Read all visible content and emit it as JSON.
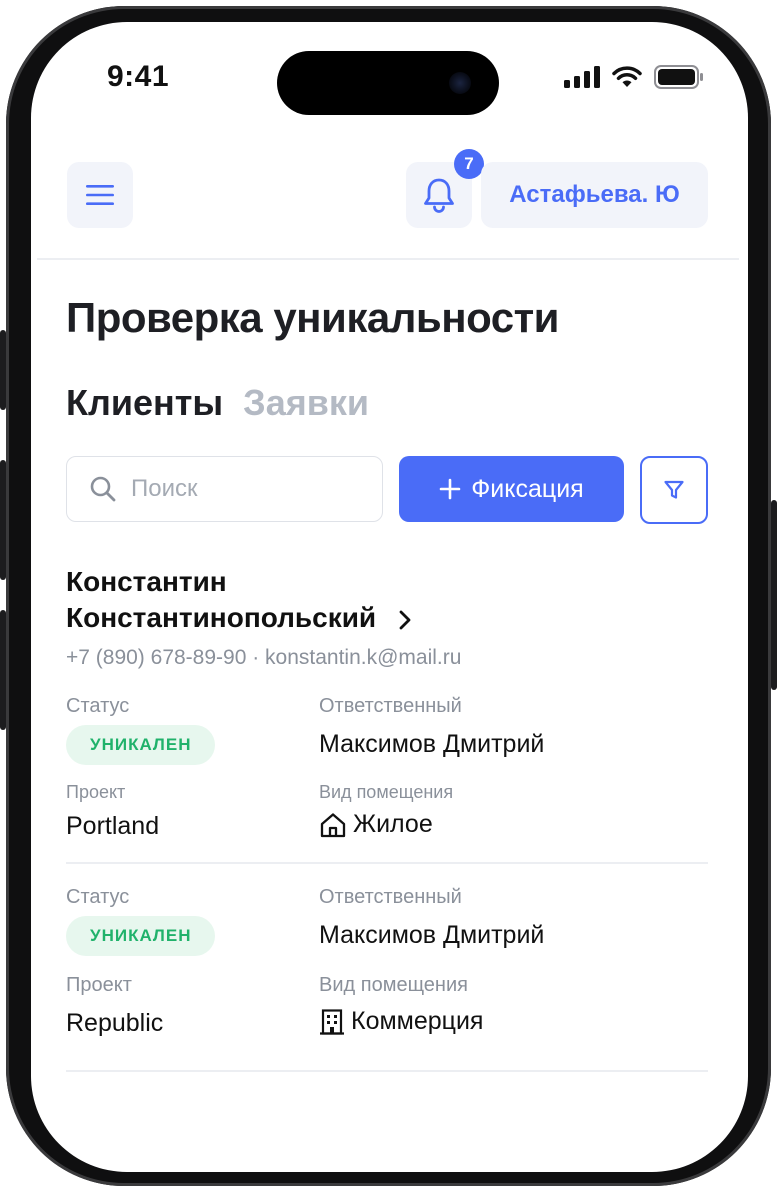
{
  "status_bar": {
    "time": "9:41"
  },
  "header": {
    "notifications_count": "7",
    "user_name": "Астафьева. Ю"
  },
  "page": {
    "title": "Проверка уникальности",
    "tabs": [
      {
        "label": "Клиенты",
        "active": true
      },
      {
        "label": "Заявки",
        "active": false
      }
    ]
  },
  "toolbar": {
    "search_placeholder": "Поиск",
    "add_button_label": "Фиксация"
  },
  "client": {
    "name_line1": "Константин",
    "name_line2": "Константинопольский",
    "contacts": "+7 (890) 678-89-90 · konstantin.k@mail.ru"
  },
  "records": [
    {
      "status_label": "Статус",
      "status_value": "УНИКАЛЕН",
      "responsible_label": "Ответственный",
      "responsible_value": "Максимов Дмитрий",
      "project_label": "Проект",
      "project_value": "Portland",
      "room_label": "Вид помещения",
      "room_value": "Жилое",
      "room_icon": "home-icon"
    },
    {
      "status_label": "Статус",
      "status_value": "УНИКАЛЕН",
      "responsible_label": "Ответственный",
      "responsible_value": "Максимов Дмитрий",
      "project_label": "Проект",
      "project_value": "Republic",
      "room_label": "Вид помещения",
      "room_value": "Коммерция",
      "room_icon": "building-icon"
    }
  ],
  "colors": {
    "accent": "#4a6cf7",
    "status_text": "#20b26b",
    "status_bg": "#e7f7ee",
    "muted_text": "#8a909a",
    "inactive_tab": "#b4bac4"
  }
}
